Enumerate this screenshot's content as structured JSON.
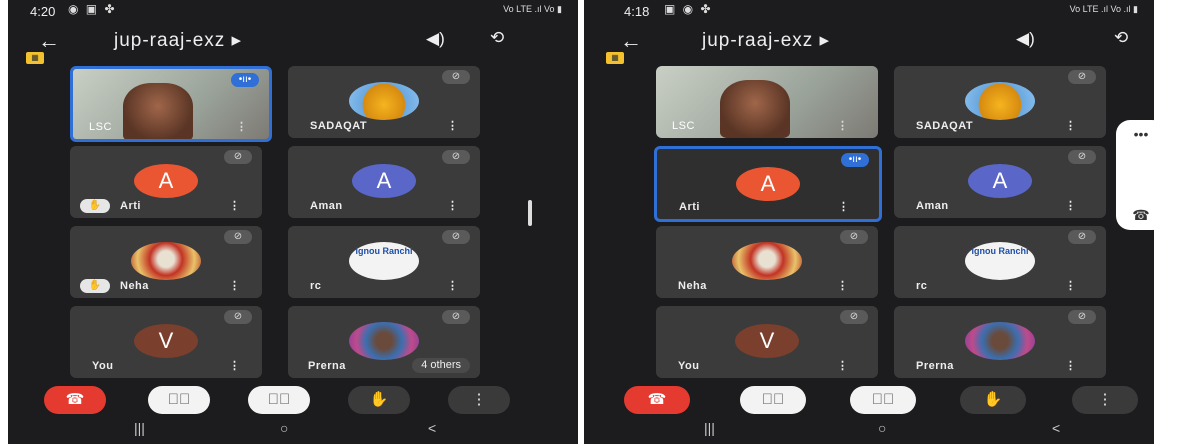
{
  "colors": {
    "end_call": "#e53a2f",
    "active_border": "#2f6fd6",
    "tile_bg": "#3b3b3b"
  },
  "left": {
    "time": "4:20",
    "status_icons": "◉ ▣ ✤",
    "status_right": "Vo LTE .ıl Vo ▮",
    "title": "jup-raaj-exz ▸",
    "speaker_icon": "speaker-icon",
    "tiles": [
      {
        "name": "LSC"
      },
      {
        "name": "SADAQAT"
      },
      {
        "name": "Arti",
        "avatar": "A",
        "avatar_color": "#ea5532"
      },
      {
        "name": "Aman",
        "avatar": "A",
        "avatar_color": "#5a67c9"
      },
      {
        "name": "Neha"
      },
      {
        "name": "rc",
        "logo_text": "ignou Ranchi"
      },
      {
        "name": "You",
        "avatar": "V",
        "avatar_color": "#7a3f2d"
      },
      {
        "name": "Prerna",
        "others": "4 others"
      }
    ]
  },
  "right": {
    "time": "4:18",
    "status_icons": "▣ ◉ ✤",
    "status_right": "Vo LTE .ıl Vo .ıl ▮",
    "title": "jup-raaj-exz ▸",
    "tiles": [
      {
        "name": "LSC"
      },
      {
        "name": "SADAQAT"
      },
      {
        "name": "Arti",
        "avatar": "A",
        "avatar_color": "#ea5532"
      },
      {
        "name": "Aman",
        "avatar": "A",
        "avatar_color": "#5a67c9"
      },
      {
        "name": "Neha"
      },
      {
        "name": "rc",
        "logo_text": "ignou Ranchi"
      },
      {
        "name": "You",
        "avatar": "V",
        "avatar_color": "#7a3f2d"
      },
      {
        "name": "Prerna"
      }
    ]
  },
  "controls": {
    "end": "☎",
    "camera": "▭⃥",
    "mic": "🎙⃥",
    "hand": "✋",
    "more": "⋮"
  },
  "nav": {
    "recents": "|||",
    "home": "○",
    "back": "<"
  },
  "side_panel": {
    "dots": "•••",
    "call_icon": "☎"
  }
}
